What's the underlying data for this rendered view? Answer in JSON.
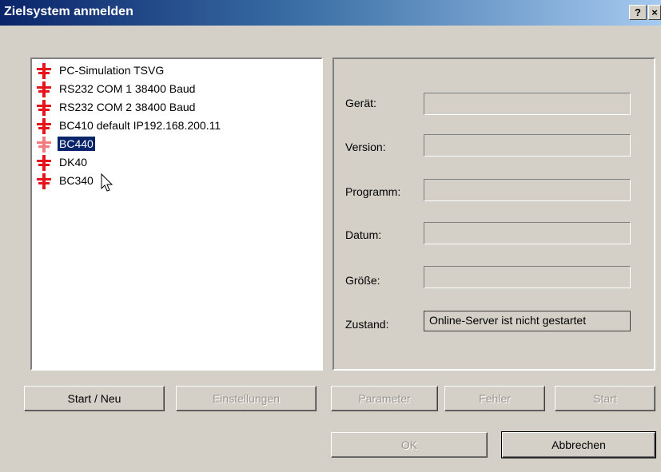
{
  "window": {
    "title": "Zielsystem anmelden",
    "help_glyph": "?",
    "close_glyph": "×"
  },
  "target_list": {
    "items": [
      {
        "label": "PC-Simulation TSVG",
        "icon": "red-device-icon",
        "selected": false
      },
      {
        "label": "RS232 COM 1 38400 Baud",
        "icon": "red-device-icon",
        "selected": false
      },
      {
        "label": "RS232 COM 2 38400 Baud",
        "icon": "red-device-icon",
        "selected": false
      },
      {
        "label": "BC410 default IP192.168.200.11",
        "icon": "red-device-icon",
        "selected": false
      },
      {
        "label": "BC440",
        "icon": "red-device-icon",
        "selected": true
      },
      {
        "label": "DK40",
        "icon": "red-device-icon",
        "selected": false
      },
      {
        "label": "BC340",
        "icon": "red-device-icon",
        "selected": false
      }
    ]
  },
  "info": {
    "device_label": "Gerät:",
    "version_label": "Version:",
    "program_label": "Programm:",
    "date_label": "Datum:",
    "size_label": "Größe:",
    "state_label": "Zustand:",
    "state_value": "Online-Server ist nicht gestartet"
  },
  "buttons": {
    "start_new": "Start / Neu",
    "settings": "Einstellungen",
    "parameter": "Parameter",
    "error": "Fehler",
    "start": "Start",
    "ok": "OK",
    "cancel": "Abbrechen"
  },
  "colors": {
    "accent": "#0a246a",
    "icon_red": "#e8141b",
    "face": "#d4d0c8"
  }
}
